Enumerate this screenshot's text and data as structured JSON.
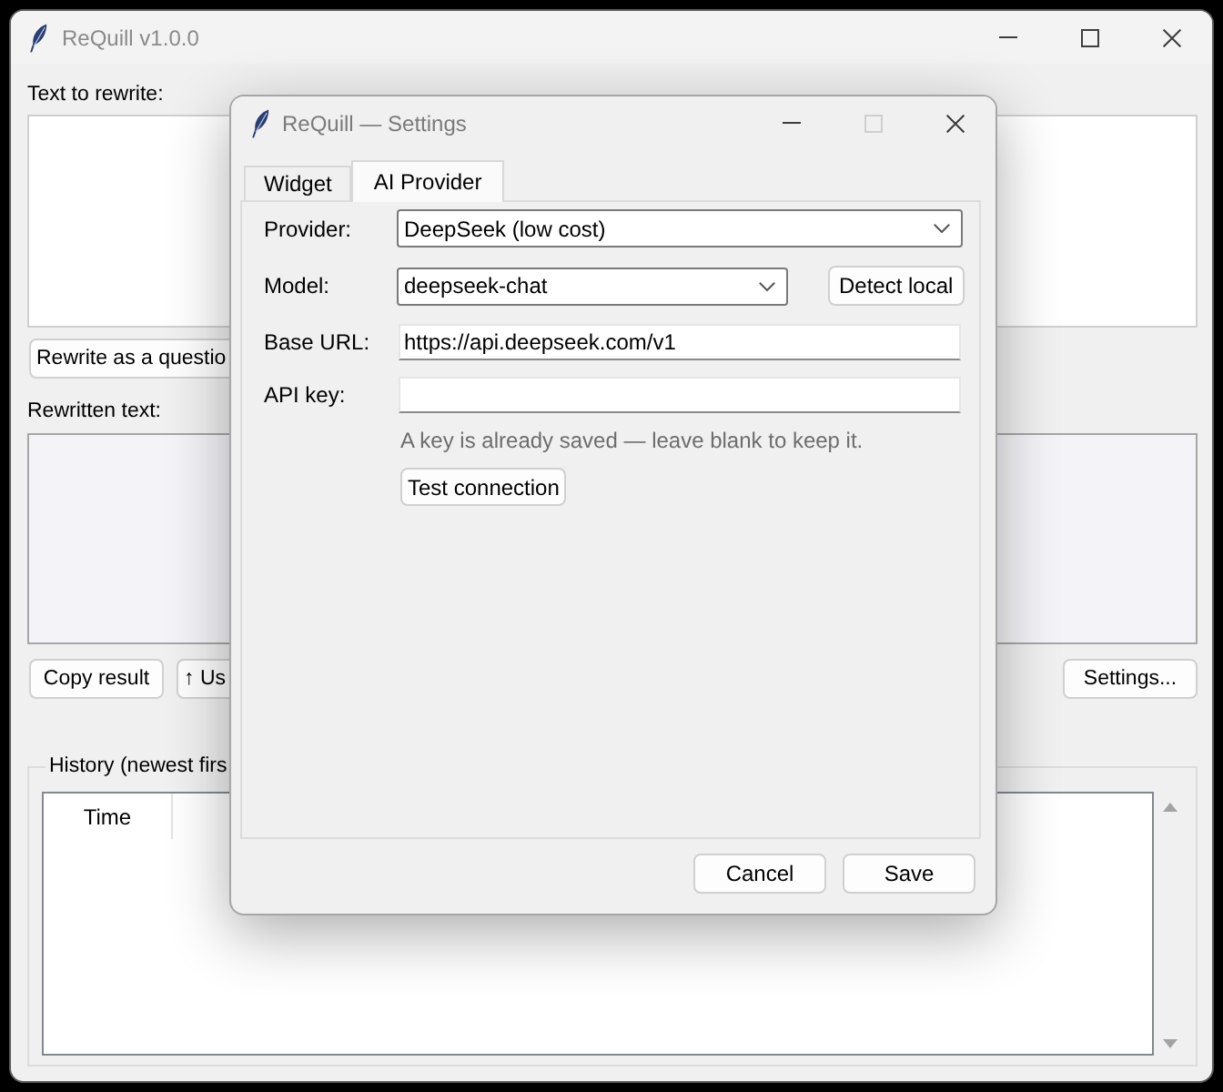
{
  "main_window": {
    "title": "ReQuill v1.0.0",
    "window_controls": [
      {
        "kind": "minimize",
        "disabled": false
      },
      {
        "kind": "maximize",
        "disabled": false
      },
      {
        "kind": "close",
        "disabled": false
      }
    ]
  },
  "input_section": {
    "label": "Text to rewrite:",
    "readonly": false
  },
  "rewrite_button": {
    "label": "Rewrite as a questio"
  },
  "output_section": {
    "label": "Rewritten text:",
    "readonly": true
  },
  "copy_button": {
    "label": "Copy result"
  },
  "use_button": {
    "label": "↑ Us"
  },
  "settings_button": {
    "label": "Settings..."
  },
  "history": {
    "title": "History (newest firs",
    "columns": [
      "Time"
    ]
  },
  "dialog": {
    "title": "ReQuill — Settings",
    "window_controls": [
      {
        "kind": "minimize",
        "disabled": false
      },
      {
        "kind": "maximize",
        "disabled": true
      },
      {
        "kind": "close",
        "disabled": false
      }
    ],
    "tabs": [
      {
        "label": "Widget",
        "selected": false
      },
      {
        "label": "AI Provider",
        "selected": true
      }
    ],
    "fields": [
      {
        "kind": "dropdown",
        "label": "Provider:",
        "value": "DeepSeek (low cost)"
      },
      {
        "kind": "dropdown",
        "label": "Model:",
        "value": "deepseek-chat",
        "button": "Detect local"
      },
      {
        "kind": "text",
        "label": "Base URL:",
        "value": "https://api.deepseek.com/v1"
      },
      {
        "kind": "text",
        "label": "API key:"
      }
    ],
    "hint": "A key is already saved — leave blank to keep it.",
    "test_button": {
      "label": "Test connection"
    },
    "footer_buttons": [
      {
        "label": "Cancel"
      },
      {
        "label": "Save"
      }
    ]
  }
}
